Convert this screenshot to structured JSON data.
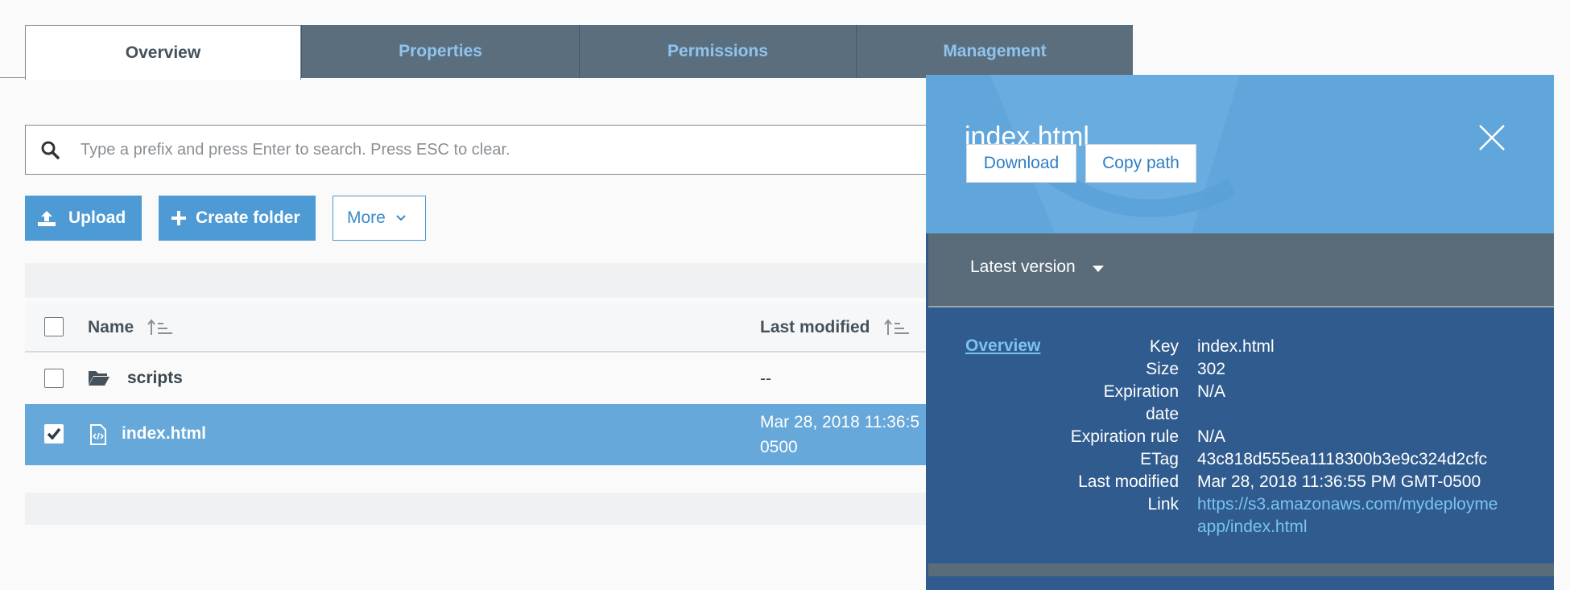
{
  "tabs": [
    {
      "label": "Overview",
      "active": true
    },
    {
      "label": "Properties",
      "active": false
    },
    {
      "label": "Permissions",
      "active": false
    },
    {
      "label": "Management",
      "active": false
    }
  ],
  "search": {
    "placeholder": "Type a prefix and press Enter to search. Press ESC to clear."
  },
  "toolbar": {
    "upload": "Upload",
    "create_folder": "Create folder",
    "more": "More"
  },
  "table": {
    "columns": {
      "name": "Name",
      "last_modified": "Last modified"
    },
    "rows": [
      {
        "name": "scripts",
        "last_modified": "--",
        "selected": false,
        "type": "folder"
      },
      {
        "name": "index.html",
        "last_modified_line1": "Mar 28, 2018 11:36:5",
        "last_modified_line2": "0500",
        "selected": true,
        "type": "file"
      }
    ]
  },
  "panel": {
    "title": "index.html",
    "download": "Download",
    "copy_path": "Copy path",
    "version": "Latest version",
    "overview_link": "Overview",
    "properties": [
      {
        "key": "Key",
        "value": "index.html"
      },
      {
        "key": "Size",
        "value": "302"
      },
      {
        "key": "Expiration",
        "key2": "date",
        "value": "N/A"
      },
      {
        "key": "Expiration rule",
        "value": "N/A"
      },
      {
        "key": "ETag",
        "value": "43c818d555ea1118300b3e9c324d2cfc"
      },
      {
        "key": "Last modified",
        "value": "Mar 28, 2018 11:36:55 PM GMT-0500"
      },
      {
        "key": "Link",
        "value_line1": "https://s3.amazonaws.com/mydeployme",
        "value_line2": "app/index.html"
      }
    ]
  },
  "colors": {
    "accent": "#4d9ad4",
    "panel_bg": "#2f5b8e",
    "tab_bg": "#5a6e7e"
  }
}
